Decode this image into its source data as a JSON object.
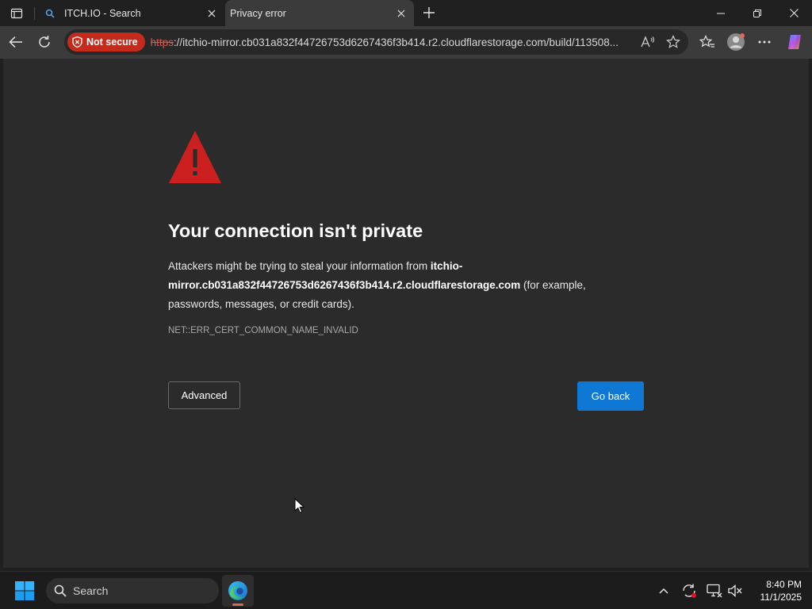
{
  "tabs": [
    {
      "title": "ITCH.IO - Search",
      "icon": "search-icon",
      "active": false
    },
    {
      "title": "Privacy error",
      "icon": "none",
      "active": true
    }
  ],
  "toolbar": {
    "security_badge": "Not secure",
    "url_scheme": "https",
    "url_rest": "://itchio-mirror.cb031a832f44726753d6267436f3b414.r2.cloudflarestorage.com/build/113508..."
  },
  "error_page": {
    "heading": "Your connection isn't private",
    "desc_before": "Attackers might be trying to steal your information from ",
    "host": "itchio-mirror.cb031a832f44726753d6267436f3b414.r2.cloudflarestorage.com",
    "desc_after": " (for example, passwords, messages, or credit cards).",
    "error_code": "NET::ERR_CERT_COMMON_NAME_INVALID",
    "advanced_label": "Advanced",
    "go_back_label": "Go back"
  },
  "taskbar": {
    "search_label": "Search",
    "time": "8:40 PM",
    "date": "11/1/2025"
  },
  "colors": {
    "accent": "#0f78d4",
    "danger": "#c42b1c",
    "warning_icon": "#cc1f1f"
  }
}
